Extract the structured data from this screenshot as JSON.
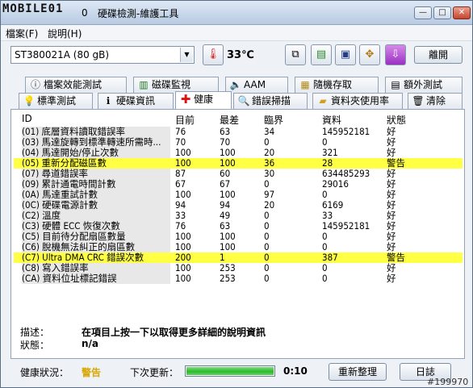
{
  "window": {
    "watermark": "MOBILE01",
    "title": "硬碟檢測-維護工具",
    "buttons": {
      "minimize": "—",
      "maximize": "□",
      "close": "✕"
    }
  },
  "menu": {
    "file": "檔案(F)",
    "help": "說明(H)"
  },
  "toolbar": {
    "drive_value": "ST380021A (80 gB)",
    "temperature": "33℃",
    "icons": [
      "copy-icon",
      "paste-icon",
      "save-icon",
      "tools-icon",
      "download-icon"
    ],
    "exit_label": "離開"
  },
  "tabs_top": [
    {
      "label": "檔案效能測試",
      "icon": "info-icon"
    },
    {
      "label": "磁碟監視",
      "icon": "chart-icon"
    },
    {
      "label": "AAM",
      "icon": "speaker-icon"
    },
    {
      "label": "隨機存取",
      "icon": "grid-icon"
    },
    {
      "label": "額外測試",
      "icon": "extra-icon"
    }
  ],
  "tabs_bottom": [
    {
      "label": "標準測試",
      "icon": "bulb-icon"
    },
    {
      "label": "硬碟資訊",
      "icon": "info-icon"
    },
    {
      "label": "健康",
      "icon": "health-cross-icon"
    },
    {
      "label": "錯誤掃描",
      "icon": "magnifier-icon"
    },
    {
      "label": "資料夾使用率",
      "icon": "folder-icon"
    },
    {
      "label": "清除",
      "icon": "trash-icon"
    }
  ],
  "table": {
    "columns": {
      "id": "ID",
      "current": "目前",
      "worst": "最差",
      "threshold": "臨界",
      "raw": "資料",
      "status": "狀態"
    },
    "rows": [
      {
        "id": "(01) 底層資料讀取錯誤率",
        "current": "76",
        "worst": "63",
        "threshold": "34",
        "raw": "145952181",
        "status": "好",
        "warn": false
      },
      {
        "id": "(03) 馬達旋轉到標準轉速所需時...",
        "current": "70",
        "worst": "70",
        "threshold": "0",
        "raw": "0",
        "status": "好",
        "warn": false
      },
      {
        "id": "(04) 馬達開始/停止次數",
        "current": "100",
        "worst": "100",
        "threshold": "20",
        "raw": "321",
        "status": "好",
        "warn": false
      },
      {
        "id": "(05) 重新分配磁區數",
        "current": "100",
        "worst": "100",
        "threshold": "36",
        "raw": "28",
        "status": "警告",
        "warn": true
      },
      {
        "id": "(07) 尋道錯誤率",
        "current": "87",
        "worst": "60",
        "threshold": "30",
        "raw": "634485293",
        "status": "好",
        "warn": false
      },
      {
        "id": "(09) 累計通電時間計數",
        "current": "67",
        "worst": "67",
        "threshold": "0",
        "raw": "29016",
        "status": "好",
        "warn": false
      },
      {
        "id": "(0A) 馬達重試計數",
        "current": "100",
        "worst": "100",
        "threshold": "97",
        "raw": "0",
        "status": "好",
        "warn": false
      },
      {
        "id": "(0C) 硬碟電源計數",
        "current": "94",
        "worst": "94",
        "threshold": "20",
        "raw": "6169",
        "status": "好",
        "warn": false
      },
      {
        "id": "(C2) 溫度",
        "current": "33",
        "worst": "49",
        "threshold": "0",
        "raw": "33",
        "status": "好",
        "warn": false
      },
      {
        "id": "(C3) 硬體 ECC 恢復次數",
        "current": "76",
        "worst": "63",
        "threshold": "0",
        "raw": "145952181",
        "status": "好",
        "warn": false
      },
      {
        "id": "(C5) 目前待分配扇區數量",
        "current": "100",
        "worst": "100",
        "threshold": "0",
        "raw": "0",
        "status": "好",
        "warn": false
      },
      {
        "id": "(C6) 脫機無法糾正的扇區數",
        "current": "100",
        "worst": "100",
        "threshold": "0",
        "raw": "0",
        "status": "好",
        "warn": false
      },
      {
        "id": "(C7) Ultra DMA CRC 錯誤次數",
        "current": "200",
        "worst": "1",
        "threshold": "0",
        "raw": "387",
        "status": "警告",
        "warn": true
      },
      {
        "id": "(C8) 寫入錯誤率",
        "current": "100",
        "worst": "253",
        "threshold": "0",
        "raw": "0",
        "status": "好",
        "warn": false
      },
      {
        "id": "(CA) 資料位址標記錯誤",
        "current": "100",
        "worst": "253",
        "threshold": "0",
        "raw": "0",
        "status": "好",
        "warn": false
      }
    ]
  },
  "details": {
    "description_label": "描述：",
    "description_value": "在項目上按一下以取得更多詳細的說明資訊",
    "status_label": "狀態：",
    "status_value": "n/a"
  },
  "footer": {
    "health_label": "健康狀況：",
    "health_value": "警告",
    "next_update_label": "下次更新：",
    "progress": 1.0,
    "countdown": "0:10",
    "refresh_label": "重新整理",
    "log_label": "日誌",
    "watermark_id": "#199970"
  },
  "colors": {
    "warn_row": "#ffff44",
    "health_warn": "#d8a800",
    "progress": "#2fb82f"
  }
}
